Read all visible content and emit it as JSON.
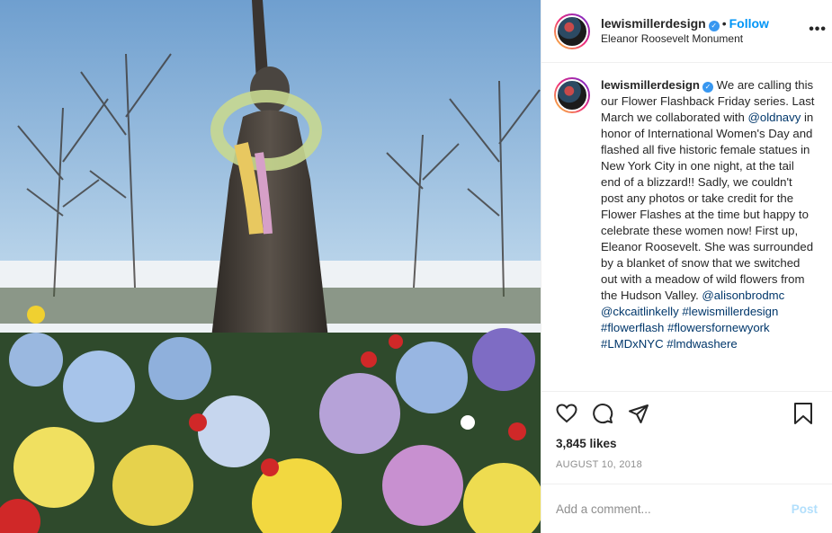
{
  "header": {
    "username": "lewismillerdesign",
    "follow_separator": "•",
    "follow_label": "Follow",
    "location": "Eleanor Roosevelt Monument",
    "more_icon": "more-horizontal-icon",
    "more_label": "•••"
  },
  "caption": {
    "username": "lewismillerdesign",
    "text_1": "We are calling this our Flower Flashback Friday series. Last March we collaborated with",
    "mention_oldnavy": "@oldnavy",
    "text_2": "in honor of International Women's Day and flashed all five historic female statues in New York City in one night, at the tail end of a blizzard!! Sadly, we couldn't post any photos or take credit for the Flower Flashes at the time but happy to celebrate these women now! First up, Eleanor Roosevelt. She was surrounded by a blanket of snow that we switched out with a meadow of wild flowers from the Hudson Valley.",
    "mention_alison": "@alisonbrodmc",
    "mention_caitlin": "@ckcaitlinkelly",
    "hashtag_1": "#lewismillerdesign",
    "hashtag_2": "#flowerflash",
    "hashtag_3": "#flowersfornewyork",
    "hashtag_4": "#LMDxNYC",
    "hashtag_5": "#lmdwashere"
  },
  "actions": {
    "icons": [
      "heart-icon",
      "comment-icon",
      "share-icon",
      "bookmark-icon"
    ]
  },
  "likes": "3,845 likes",
  "date": "AUGUST 10, 2018",
  "comment": {
    "placeholder": "Add a comment...",
    "post_label": "Post"
  },
  "colors": {
    "link_blue": "#0095f6",
    "tag_navy": "#00376b",
    "post_disabled": "#b2dffc",
    "muted_gray": "#8e8e8e"
  }
}
